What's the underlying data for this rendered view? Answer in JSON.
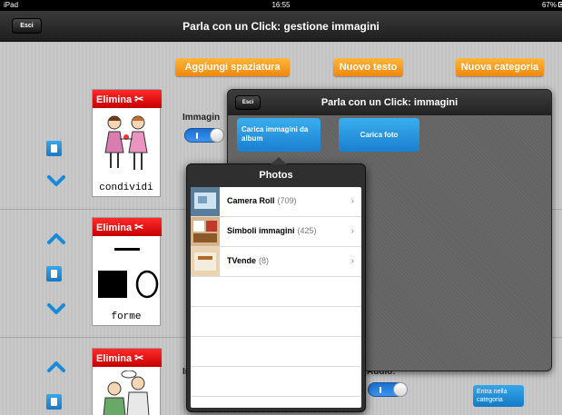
{
  "status_bar": {
    "device": "iPad",
    "time": "16:55",
    "battery": "67%"
  },
  "navbar": {
    "back_label": "Esci",
    "title": "Parla con un Click: gestione immagini"
  },
  "toolbar": {
    "add_spacing_label": "Aggiungi spaziatura",
    "new_text_label": "Nuovo testo",
    "new_category_label": "Nuova categoria"
  },
  "cards": [
    {
      "delete_label": "Elimina",
      "label": "condividi"
    },
    {
      "delete_label": "Elimina",
      "label": "forme"
    },
    {
      "delete_label": "Elimina",
      "label": ""
    }
  ],
  "side": {
    "image_label": "Immagin",
    "audio_label": "Audio:",
    "enter_category_label": "Entra nella categoria"
  },
  "popup": {
    "back_label": "Esci",
    "title": "Parla con un Click: immagini",
    "load_album_label": "Carica immagini da album",
    "load_photo_label": "Carica foto"
  },
  "photos": {
    "title": "Photos",
    "albums": [
      {
        "name": "Camera Roll",
        "count": "(709)"
      },
      {
        "name": "Simboli immagini",
        "count": "(425)"
      },
      {
        "name": "TVende",
        "count": "(8)"
      }
    ]
  },
  "colors": {
    "orange": "#f0870e",
    "red": "#d60000",
    "blue": "#1a7fd0"
  }
}
